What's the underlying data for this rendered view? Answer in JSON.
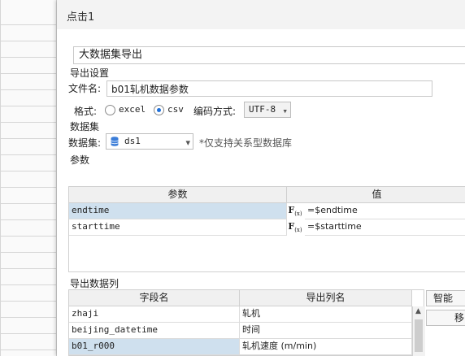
{
  "dialog": {
    "title": "点击1"
  },
  "action_name": "大数据集导出",
  "export_settings": {
    "section_title": "导出设置",
    "filename_label": "文件名:",
    "filename_value": "b01轧机数据参数",
    "format_label": "格式:",
    "format_options": [
      "excel",
      "csv"
    ],
    "format_selected": "csv",
    "encoding_label": "编码方式:",
    "encoding_value": "UTF-8"
  },
  "dataset": {
    "section_title": "数据集",
    "label": "数据集:",
    "value": "ds1",
    "note": "*仅支持关系型数据库"
  },
  "params": {
    "section_title": "参数",
    "headers": [
      "参数",
      "值"
    ],
    "rows": [
      {
        "name": "endtime",
        "value": "=$endtime",
        "selected": true
      },
      {
        "name": "starttime",
        "value": "=$starttime",
        "selected": false
      }
    ]
  },
  "columns": {
    "section_title": "导出数据列",
    "headers": [
      "字段名",
      "导出列名"
    ],
    "rows": [
      {
        "field": "zhaji",
        "export": "轧机",
        "selected": false
      },
      {
        "field": "beijing_datetime",
        "export": "时间",
        "selected": false
      },
      {
        "field": "b01_r000",
        "export": "轧机速度 (m/min)",
        "selected": true
      }
    ],
    "side_buttons": [
      "智能",
      "移"
    ]
  },
  "icons": {
    "dataset_icon": "database-icon",
    "formula_icon": "fx-icon",
    "dropdown_icon": "chevron-down-icon"
  },
  "colors": {
    "selected_row": "#cfe0ee",
    "radio_on": "#1e6fd9"
  }
}
